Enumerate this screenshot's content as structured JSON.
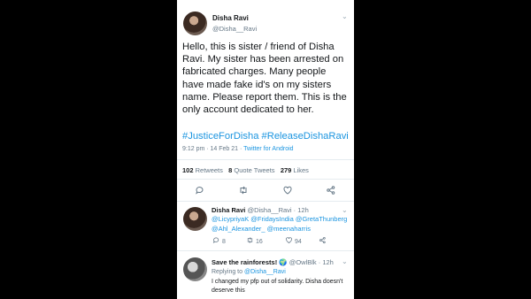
{
  "tweet": {
    "name": "Disha Ravi",
    "handle": "@Disha__Ravi",
    "body": "Hello, this is sister / friend of Disha Ravi. My sister has been arrested on fabricated charges. Many people have made fake id's on my sisters name. Please report them. This is the only account dedicated to her.",
    "hashtags": "#JusticeForDisha #ReleaseDishaRavi",
    "time": "9:12 pm · 14 Feb 21 · ",
    "source": "Twitter for Android",
    "retweets_count": "102",
    "retweets_label": "Retweets",
    "quote_count": "8",
    "quote_label": "Quote Tweets",
    "likes_count": "279",
    "likes_label": "Likes"
  },
  "reply1": {
    "name": "Disha Ravi",
    "handle_time": "@Disha__Ravi · 12h",
    "mentions_line1": "@LicypriyaK @FridaysIndia @GretaThunberg",
    "mentions_line2": "@Ahl_Alexander_ @meenaharris",
    "replies": "8",
    "retweets": "16",
    "likes": "94"
  },
  "reply2": {
    "name": "Save the rainforests! 🌍",
    "handle_time": "@OwlBlk · 12h",
    "replying_prefix": "Replying to",
    "replying_to": "@Disha__Ravi",
    "text": "I changed my pfp out of solidarity. Disha doesn't deserve this"
  },
  "icons": [
    "chevron-down-icon",
    "reply-icon",
    "retweet-icon",
    "like-icon",
    "share-icon"
  ]
}
